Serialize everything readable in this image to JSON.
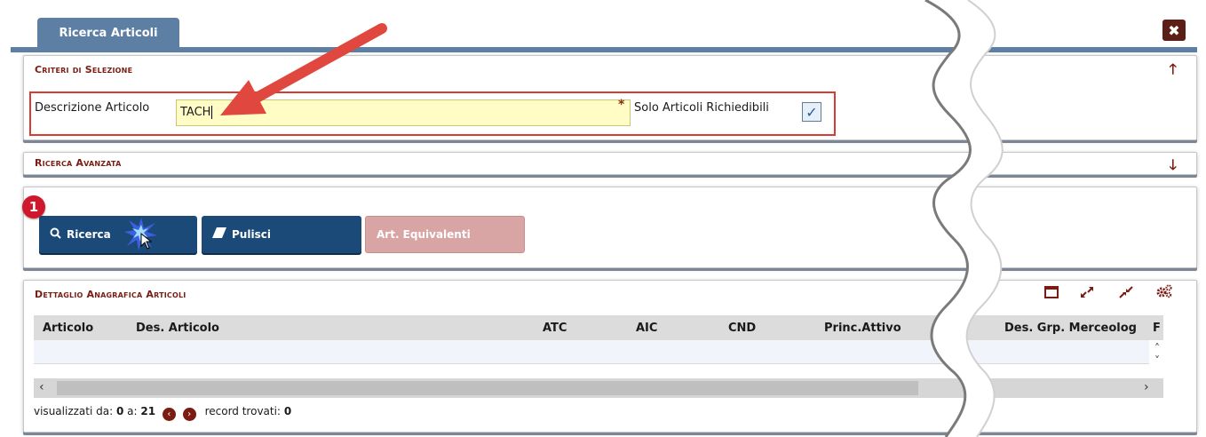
{
  "tab": {
    "label": "Ricerca Articoli"
  },
  "close": {
    "symbol": "✖"
  },
  "criteria": {
    "title": "Criteri di Selezione",
    "description_label": "Descrizione Articolo",
    "description_value": "TACH",
    "required_mark": "*",
    "only_requestable_label": "Solo Articoli Richiedibili",
    "only_requestable_checked": true,
    "check_symbol": "✓",
    "collapse_symbol": "🡑"
  },
  "advanced": {
    "title": "Ricerca Avanzata",
    "expand_symbol": "🡓"
  },
  "actions": {
    "badge": "1",
    "search_label": "Ricerca",
    "clear_label": "Pulisci",
    "equivalents_label": "Art. Equivalenti"
  },
  "detail": {
    "title": "Dettaglio Anagrafica Articoli",
    "columns": [
      "Articolo",
      "Des. Articolo",
      "ATC",
      "AIC",
      "CND",
      "Princ.Attivo",
      "Des. Grp. Merceolog",
      "F"
    ],
    "footer": {
      "shown_from_label": "visualizzati da:",
      "from_value": "0",
      "to_label": "a:",
      "to_value": "21",
      "records_label": "record trovati:",
      "records_value": "0"
    }
  },
  "colors": {
    "tab_blue": "#5d7fa3",
    "button_blue": "#1b4a78",
    "section_title": "#7b1c12",
    "highlight_red": "#d73b32",
    "input_yellow": "#fffdc5"
  }
}
